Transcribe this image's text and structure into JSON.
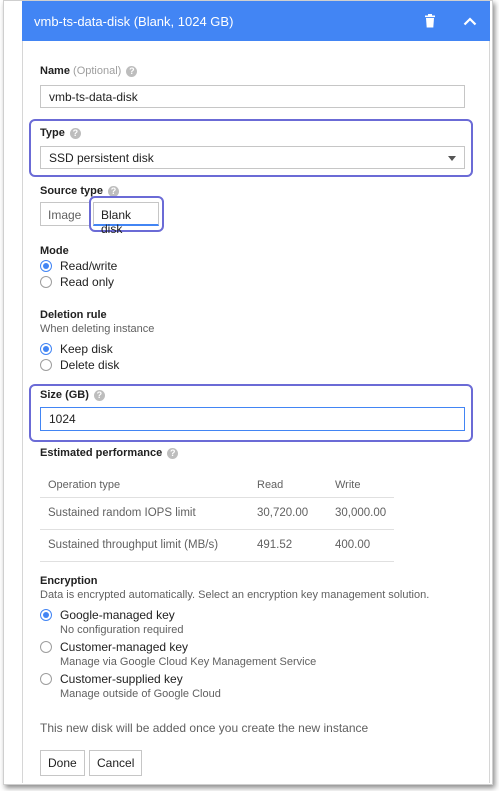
{
  "header": {
    "title": "vmb-ts-data-disk (Blank, 1024 GB)",
    "delete_icon": "trash-icon",
    "collapse_icon": "chevron-up-icon",
    "bg_color": "#4285f4"
  },
  "name": {
    "label": "Name",
    "optional": "(Optional)",
    "value": "vmb-ts-data-disk"
  },
  "type": {
    "label": "Type",
    "selected": "SSD persistent disk"
  },
  "source_type": {
    "label": "Source type",
    "options": [
      "Image",
      "Blank disk"
    ],
    "selected": "Blank disk"
  },
  "mode": {
    "label": "Mode",
    "options": [
      "Read/write",
      "Read only"
    ],
    "selected": "Read/write"
  },
  "deletion_rule": {
    "label": "Deletion rule",
    "sub": "When deleting instance",
    "options": [
      "Keep disk",
      "Delete disk"
    ],
    "selected": "Keep disk"
  },
  "size": {
    "label": "Size (GB)",
    "value": "1024"
  },
  "performance": {
    "label": "Estimated performance",
    "headers": [
      "Operation type",
      "Read",
      "Write"
    ],
    "rows": [
      [
        "Sustained random IOPS limit",
        "30,720.00",
        "30,000.00"
      ],
      [
        "Sustained throughput limit (MB/s)",
        "491.52",
        "400.00"
      ]
    ]
  },
  "encryption": {
    "label": "Encryption",
    "sub": "Data is encrypted automatically. Select an encryption key management solution.",
    "options": [
      {
        "label": "Google-managed key",
        "desc": "No configuration required"
      },
      {
        "label": "Customer-managed key",
        "desc": "Manage via Google Cloud Key Management Service"
      },
      {
        "label": "Customer-supplied key",
        "desc": "Manage outside of Google Cloud"
      }
    ],
    "selected": "Google-managed key"
  },
  "footer_note": "This new disk will be added once you create the new instance",
  "buttons": {
    "done": "Done",
    "cancel": "Cancel"
  },
  "accent_color": "#4285f4",
  "highlight_color": "#6b6bd6"
}
